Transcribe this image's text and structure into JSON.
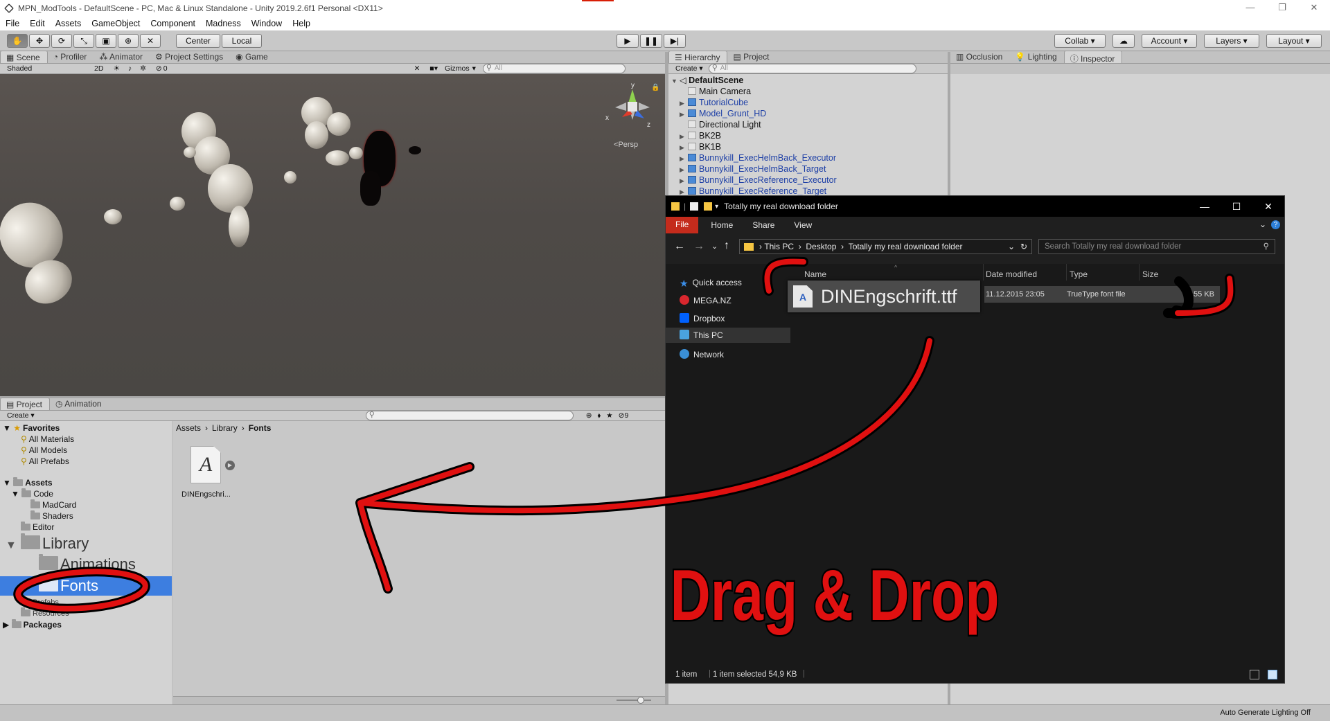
{
  "window": {
    "title": "MPN_ModTools - DefaultScene - PC, Mac & Linux Standalone - Unity 2019.2.6f1 Personal <DX11>",
    "controls": [
      "—",
      "❐",
      "✕"
    ]
  },
  "menu": [
    "File",
    "Edit",
    "Assets",
    "GameObject",
    "Component",
    "Madness",
    "Window",
    "Help"
  ],
  "toolbar": {
    "pivot": "Center",
    "space": "Local",
    "collab": "Collab ▾",
    "account": "Account",
    "layers": "Layers",
    "layout": "Layout"
  },
  "scene_tabs": [
    "Scene",
    "Profiler",
    "Animator",
    "Project Settings",
    "Game"
  ],
  "scene_bar": {
    "shading": "Shaded",
    "mode_2d": "2D",
    "fx_count": "0",
    "gizmos": "Gizmos",
    "search_placeholder": "All",
    "persp": "Persp",
    "axes": {
      "x": "x",
      "y": "y",
      "z": "z"
    }
  },
  "hierarchy": {
    "tabs": [
      "Hierarchy",
      "Project"
    ],
    "create": "Create ▾",
    "search_placeholder": "All",
    "scene_name": "DefaultScene",
    "items": [
      {
        "name": "Main Camera",
        "blue": false,
        "expandable": false
      },
      {
        "name": "TutorialCube",
        "blue": true,
        "expandable": true
      },
      {
        "name": "Model_Grunt_HD",
        "blue": true,
        "expandable": true
      },
      {
        "name": "Directional Light",
        "blue": false,
        "expandable": false
      },
      {
        "name": "BK2B",
        "blue": false,
        "expandable": true
      },
      {
        "name": "BK1B",
        "blue": false,
        "expandable": true
      },
      {
        "name": "Bunnykill_ExecHelmBack_Executor",
        "blue": true,
        "expandable": true
      },
      {
        "name": "Bunnykill_ExecHelmBack_Target",
        "blue": true,
        "expandable": true
      },
      {
        "name": "Bunnykill_ExecReference_Executor",
        "blue": true,
        "expandable": true
      },
      {
        "name": "Bunnykill_ExecReference_Target",
        "blue": true,
        "expandable": true
      }
    ]
  },
  "inspector_tabs": [
    "Occlusion",
    "Lighting",
    "Inspector"
  ],
  "project": {
    "tabs": [
      "Project",
      "Animation"
    ],
    "create": "Create ▾",
    "count_badge": "9",
    "breadcrumb": [
      "Assets",
      "Library",
      "Fonts"
    ],
    "tree": {
      "favorites": "Favorites",
      "favorite_items": [
        "All Materials",
        "All Models",
        "All Prefabs"
      ],
      "assets": "Assets",
      "code": "Code",
      "code_children": [
        "MadCard",
        "Shaders"
      ],
      "editor": "Editor",
      "library": "Library",
      "animations": "Animations",
      "fonts": "Fonts",
      "prefabs": "Prefabs",
      "resources": "Resources",
      "packages": "Packages"
    },
    "asset": {
      "label": "DINEngschri...",
      "glyph": "A"
    }
  },
  "statusbar": {
    "lighting": "Auto Generate Lighting Off"
  },
  "explorer": {
    "title": "Totally my real download folder",
    "ribbon": [
      "File",
      "Home",
      "Share",
      "View"
    ],
    "path": [
      "This PC",
      "Desktop",
      "Totally my real download folder"
    ],
    "search_placeholder": "Search Totally my real download folder",
    "nav": [
      "Quick access",
      "MEGA.NZ",
      "Dropbox",
      "This PC",
      "Network"
    ],
    "columns": [
      "Name",
      "Date modified",
      "Type",
      "Size"
    ],
    "file": {
      "name": "DINEngschrift.ttf",
      "date": "11.12.2015 23:05",
      "type": "TrueType font file",
      "size": "55 KB"
    },
    "status": {
      "items": "1 item",
      "selected": "1 item selected  54,9 KB"
    }
  },
  "annotation": {
    "text": "Drag & Drop"
  },
  "colors": {
    "annotation_red": "#e01010",
    "selection_blue": "#3d7ee0",
    "unity_gray": "#c2c2c2",
    "explorer_bg": "#191919"
  }
}
